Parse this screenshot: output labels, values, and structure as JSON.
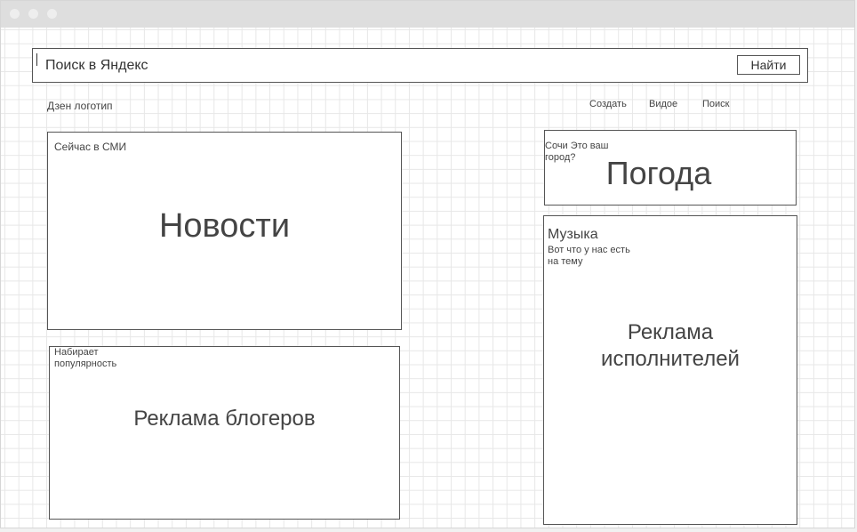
{
  "search": {
    "placeholder": "Поиск в Яндекс",
    "button_label": "Найти"
  },
  "header": {
    "logo_text": "Дзен логотип",
    "nav": [
      "Создать",
      "Видое",
      "Поиск"
    ]
  },
  "news": {
    "caption": "Сейчас в СМИ",
    "title": "Новости"
  },
  "bloggers": {
    "caption_line1": "Набирает",
    "caption_line2": "популярность",
    "title": "Реклама блогеров"
  },
  "weather": {
    "caption_line1": "Сочи Это ваш",
    "caption_line2": "город?",
    "title": "Погода"
  },
  "music": {
    "heading": "Музыка",
    "caption_line1": "Вот что у нас есть",
    "caption_line2": "на тему",
    "title_line1": "Реклама",
    "title_line2": "исполнителей"
  }
}
